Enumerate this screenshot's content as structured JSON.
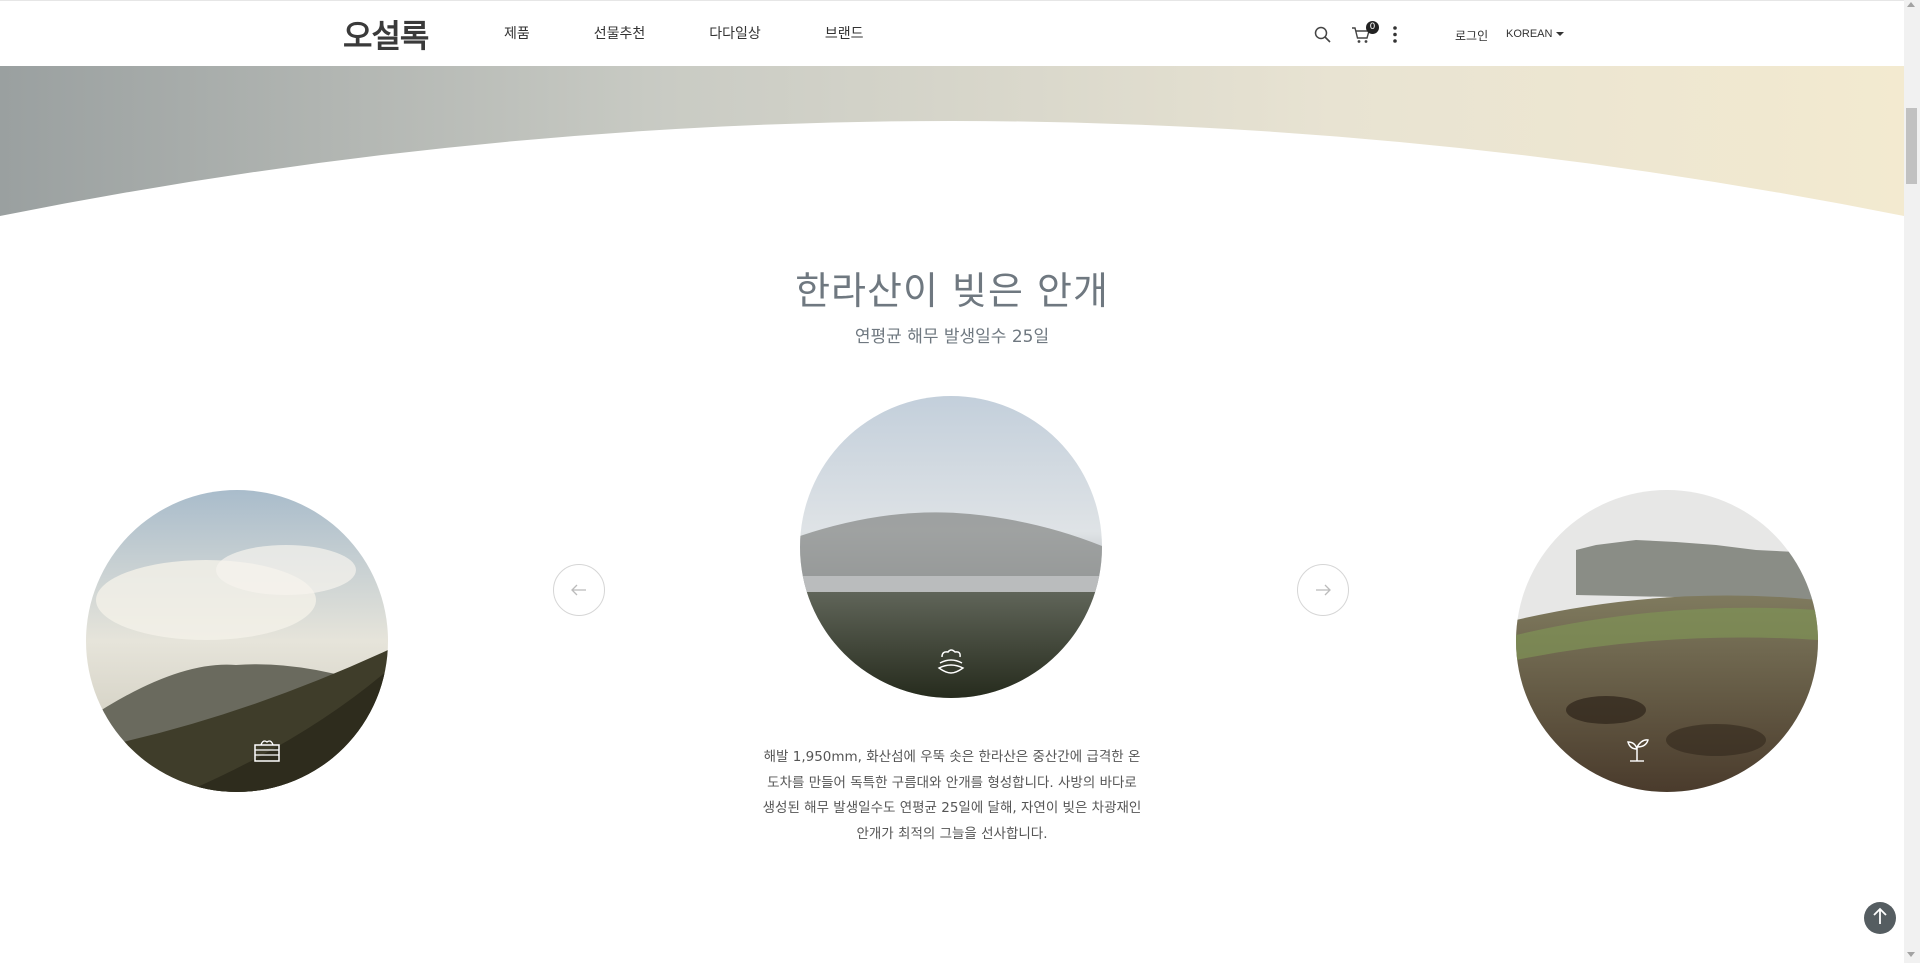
{
  "header": {
    "logo": "오설록",
    "nav": [
      "제품",
      "선물추천",
      "다다일상",
      "브랜드"
    ],
    "cart_count": "0",
    "login": "로그인",
    "language": "KOREAN"
  },
  "section": {
    "title": "한라산이 빚은 안개",
    "subtitle": "연평균 해무 발생일수 25일",
    "description": "해발 1,950mm, 화산섬에 우뚝 솟은 한라산은 중산간에 급격한 온도차를 만들어 독특한 구름대와 안개를 형성합니다. 사방의 바다로 생성된 해무 발생일수도 연평균 25일에 달해, 자연이 빚은 차광재인 안개가 최적의 그늘을 선사합니다."
  },
  "carousel": {
    "slides": [
      "cloudy-mountain-slope",
      "foggy-tea-field",
      "misty-farmland"
    ],
    "slide_icons": [
      "tea-box-icon",
      "cloud-fog-icon",
      "sprout-icon"
    ]
  },
  "icons": {
    "search": "search-icon",
    "cart": "cart-icon",
    "more": "kebab-menu-icon",
    "prev": "arrow-left-icon",
    "next": "arrow-right-icon",
    "top": "arrow-up-icon"
  },
  "colors": {
    "title": "#6f7880",
    "top_button": "#555d61"
  }
}
